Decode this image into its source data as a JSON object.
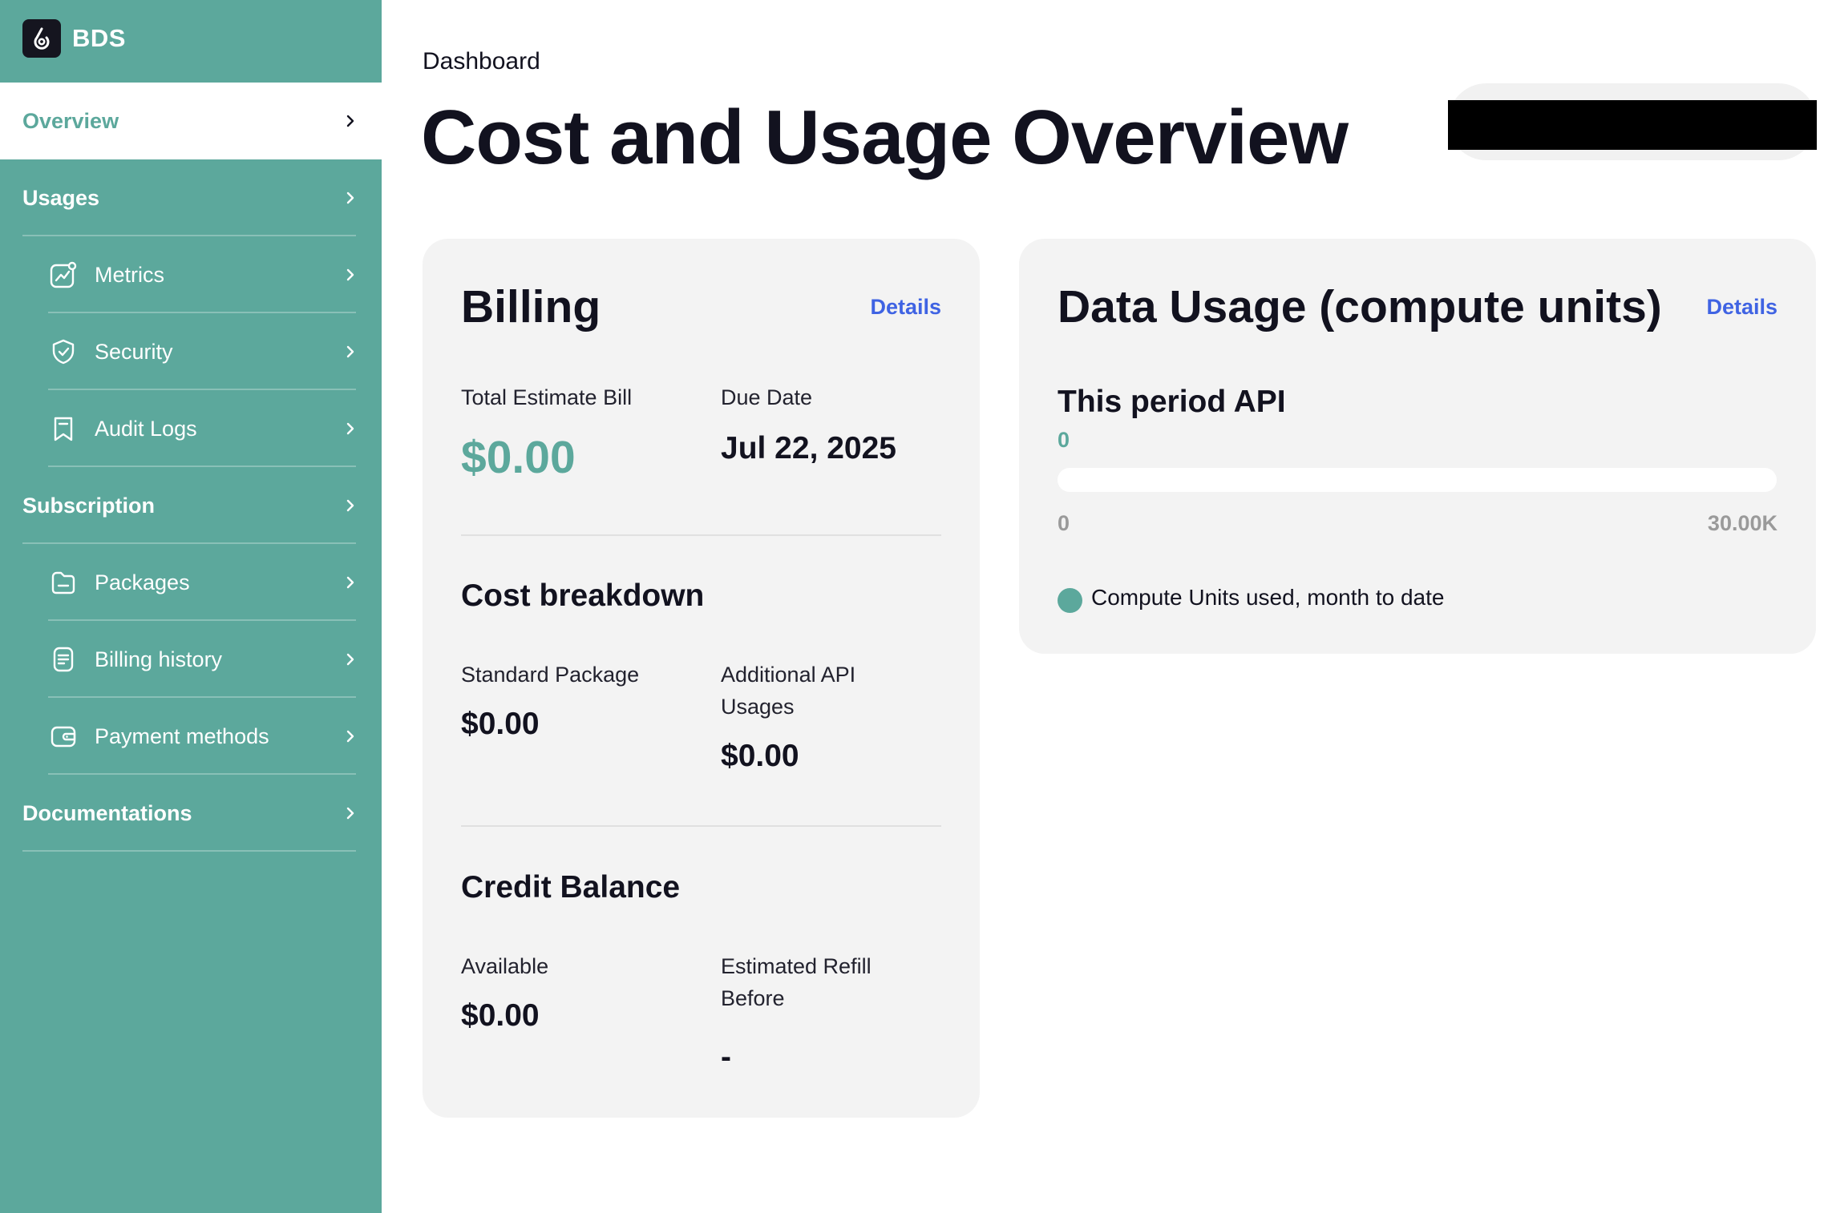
{
  "brand": {
    "name": "BDS"
  },
  "sidebar": {
    "items": [
      {
        "label": "Overview",
        "kind": "section",
        "active": true
      },
      {
        "label": "Usages",
        "kind": "section"
      },
      {
        "label": "Metrics",
        "kind": "sub",
        "icon": "chart-icon"
      },
      {
        "label": "Security",
        "kind": "sub",
        "icon": "shield-icon"
      },
      {
        "label": "Audit Logs",
        "kind": "sub",
        "icon": "bookmark-icon"
      },
      {
        "label": "Subscription",
        "kind": "section"
      },
      {
        "label": "Packages",
        "kind": "sub",
        "icon": "folder-icon"
      },
      {
        "label": "Billing history",
        "kind": "sub",
        "icon": "document-icon"
      },
      {
        "label": "Payment methods",
        "kind": "sub",
        "icon": "wallet-icon"
      },
      {
        "label": "Documentations",
        "kind": "section"
      }
    ]
  },
  "header": {
    "breadcrumb": "Dashboard",
    "title": "Cost and Usage Overview"
  },
  "billing": {
    "title": "Billing",
    "details_label": "Details",
    "total_label": "Total Estimate Bill",
    "total_value": "$0.00",
    "due_label": "Due Date",
    "due_value": "Jul 22, 2025",
    "breakdown_title": "Cost breakdown",
    "standard_label": "Standard Package",
    "standard_value": "$0.00",
    "additional_label": "Additional API Usages",
    "additional_value": "$0.00",
    "credit_title": "Credit Balance",
    "available_label": "Available",
    "available_value": "$0.00",
    "refill_label": "Estimated Refill Before",
    "refill_value": "-"
  },
  "usage": {
    "title": "Data Usage (compute units)",
    "details_label": "Details",
    "period_title": "This period API",
    "current_value": "0",
    "progress_fraction": 0,
    "range_min": "0",
    "range_max": "30.00K",
    "legend_label": "Compute Units used, month to date"
  },
  "colors": {
    "brand_teal": "#5ca89c",
    "link_blue": "#3f63e3",
    "dark": "#12121f",
    "card_bg": "#f3f3f3"
  }
}
